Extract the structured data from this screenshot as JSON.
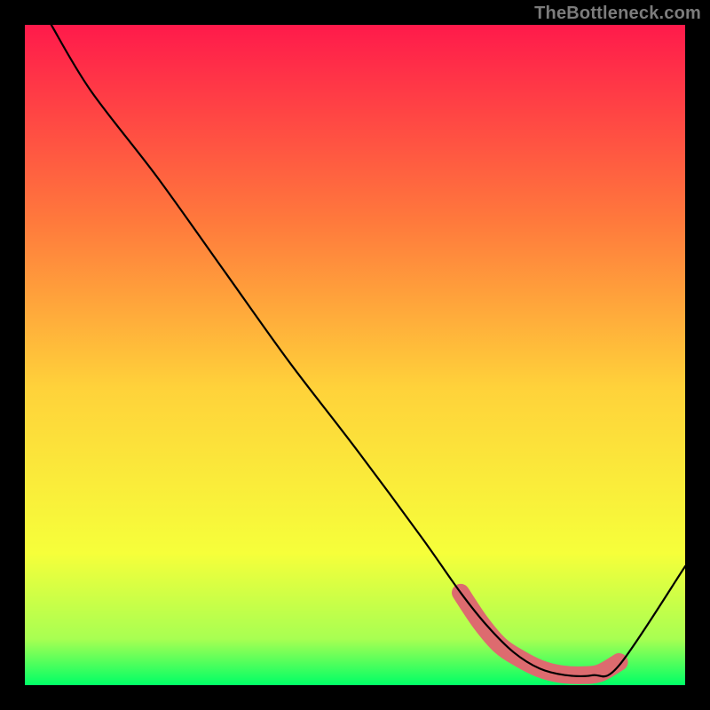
{
  "watermark": "TheBottleneck.com",
  "chart_data": {
    "type": "line",
    "title": "",
    "xlabel": "",
    "ylabel": "",
    "xlim": [
      0,
      100
    ],
    "ylim": [
      0,
      100
    ],
    "gradient_colors": {
      "top": "#ff1a4b",
      "mid_upper": "#ff7a3c",
      "mid": "#ffd23a",
      "mid_lower": "#f6ff3a",
      "light_green": "#a8ff52",
      "bottom": "#00ff66"
    },
    "curve_black": {
      "x": [
        4,
        10,
        20,
        30,
        40,
        50,
        60,
        66,
        70,
        74,
        78,
        82,
        86,
        90,
        100
      ],
      "y": [
        100,
        90,
        77,
        63,
        49,
        36,
        22.5,
        14,
        9,
        5,
        2.5,
        1.5,
        1.5,
        3,
        18
      ]
    },
    "highlight_band_pink": {
      "x": [
        66,
        69,
        72,
        75,
        78,
        81,
        84,
        87,
        90
      ],
      "y": [
        14,
        9.5,
        6,
        4,
        2.5,
        1.7,
        1.5,
        1.8,
        3.5
      ],
      "stroke_width_pct": 2.5,
      "color": "#dd6b6f"
    }
  }
}
